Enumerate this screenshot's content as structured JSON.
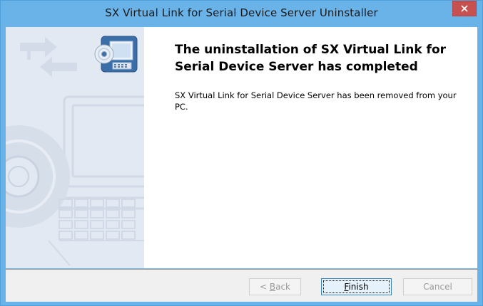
{
  "window": {
    "title": "SX Virtual Link for Serial Device Server Uninstaller",
    "close_glyph": "×",
    "titlebar_color": "#6ab3e8",
    "close_color": "#c75050"
  },
  "side_panel": {
    "art_icons": [
      "arrows-icon",
      "installer-monitor-disc-icon",
      "laptop-icon",
      "cd-disc-icon",
      "keyboard-icon"
    ]
  },
  "main": {
    "headline": "The uninstallation of SX Virtual Link for Serial Device Server has completed",
    "message": "SX Virtual Link for Serial Device Server has been removed from your PC."
  },
  "buttons": {
    "back": {
      "mnemonic": "B",
      "rest": "ack",
      "prefix": "< ",
      "enabled": false
    },
    "finish": {
      "mnemonic": "F",
      "rest": "inish",
      "enabled": true,
      "default": true
    },
    "cancel": {
      "label": "Cancel",
      "enabled": false
    }
  }
}
